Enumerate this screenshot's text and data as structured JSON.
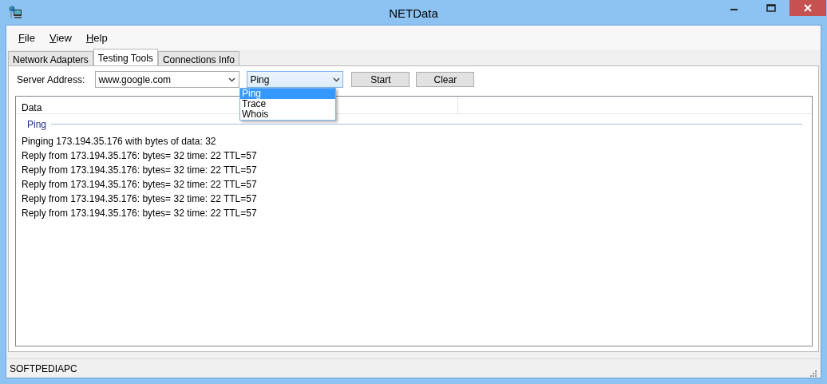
{
  "window": {
    "title": "NETData"
  },
  "menu": [
    "File",
    "View",
    "Help"
  ],
  "tabs": [
    {
      "label": "Network Adapters",
      "selected": false
    },
    {
      "label": "Testing Tools",
      "selected": true
    },
    {
      "label": "Connections Info",
      "selected": false
    }
  ],
  "toolbar": {
    "server_label": "Server Address:",
    "server_value": "www.google.com",
    "tool_value": "Ping",
    "tool_options": [
      {
        "label": "Ping",
        "selected": true
      },
      {
        "label": "Trace",
        "selected": false
      },
      {
        "label": "Whois",
        "selected": false
      }
    ],
    "buttons": [
      "Start",
      "Clear"
    ]
  },
  "list": {
    "columns": [
      "Data"
    ],
    "group": "Ping",
    "rows": [
      "Pinging 173.194.35.176 with bytes of data: 32",
      "Reply from 173.194.35.176: bytes= 32 time: 22 TTL=57",
      "Reply from 173.194.35.176: bytes= 32 time: 22 TTL=57",
      "Reply from 173.194.35.176: bytes= 32 time: 22 TTL=57",
      "Reply from 173.194.35.176: bytes= 32 time: 22 TTL=57",
      "Reply from 173.194.35.176: bytes= 32 time: 22 TTL=57"
    ]
  },
  "status_bar": "SOFTPEDIAPC"
}
